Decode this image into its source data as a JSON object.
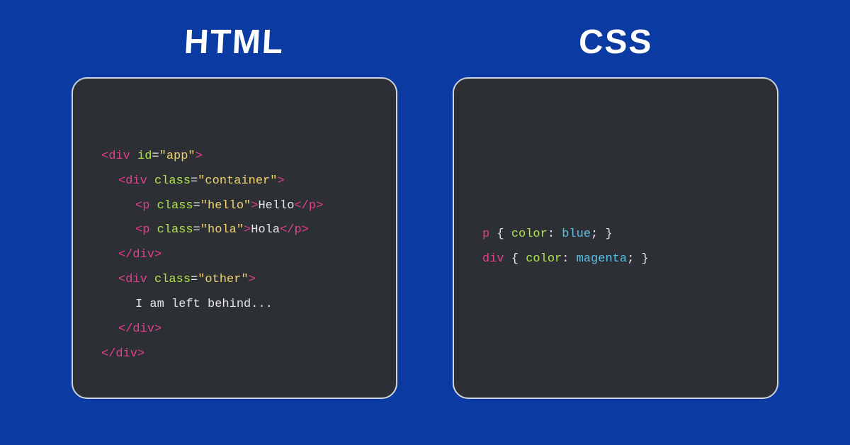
{
  "left": {
    "heading": "HTML",
    "code": {
      "tag_div": "div",
      "tag_p": "p",
      "attr_id": "id",
      "attr_class": "class",
      "val_app": "\"app\"",
      "val_container": "\"container\"",
      "val_hello": "\"hello\"",
      "val_hola": "\"hola\"",
      "val_other": "\"other\"",
      "text_hello": "Hello",
      "text_hola": "Hola",
      "text_left_behind": "I am left behind..."
    }
  },
  "right": {
    "heading": "CSS",
    "code": {
      "sel_p": "p",
      "sel_div": "div",
      "prop_color": "color",
      "val_blue": "blue",
      "val_magenta": "magenta"
    }
  }
}
